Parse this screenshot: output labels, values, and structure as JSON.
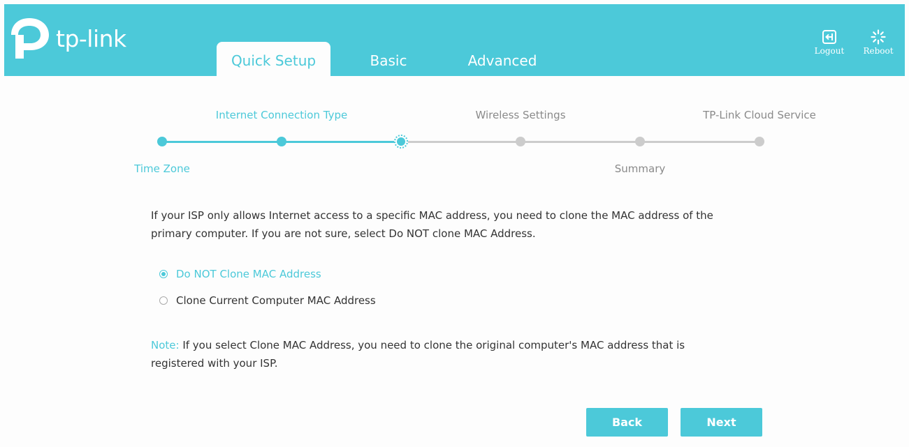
{
  "brand": {
    "name": "tp-link"
  },
  "tabs": [
    {
      "label": "Quick Setup",
      "active": true
    },
    {
      "label": "Basic",
      "active": false
    },
    {
      "label": "Advanced",
      "active": false
    }
  ],
  "header_buttons": {
    "logout": {
      "label": "Logout",
      "icon": "logout-icon"
    },
    "reboot": {
      "label": "Reboot",
      "icon": "reboot-icon"
    }
  },
  "wizard": {
    "steps_top": [
      {
        "label": "Internet Connection Type",
        "state": "done"
      },
      {
        "label": "Wireless Settings",
        "state": "pending"
      },
      {
        "label": "TP-Link Cloud Service",
        "state": "pending"
      }
    ],
    "steps_bottom": [
      {
        "label": "Time Zone",
        "state": "done"
      },
      {
        "label": "Summary",
        "state": "pending"
      }
    ],
    "current_step_index": 2,
    "total_steps": 6
  },
  "content": {
    "intro_line1": "If your ISP only allows Internet access to a specific MAC address, you need to clone the MAC address of the",
    "intro_line2": "primary computer. If you are not sure, select Do NOT clone MAC Address.",
    "options": [
      {
        "label": "Do NOT Clone MAC Address",
        "checked": true
      },
      {
        "label": "Clone Current Computer MAC Address",
        "checked": false
      }
    ],
    "note_key": "Note:",
    "note_line1": " If you select Clone MAC Address, you need to clone the original computer's MAC address that is",
    "note_line2": "registered with your ISP."
  },
  "buttons": {
    "back": "Back",
    "next": "Next"
  },
  "colors": {
    "accent": "#4cc9d9",
    "pending": "#cccccc",
    "text": "#333333"
  }
}
